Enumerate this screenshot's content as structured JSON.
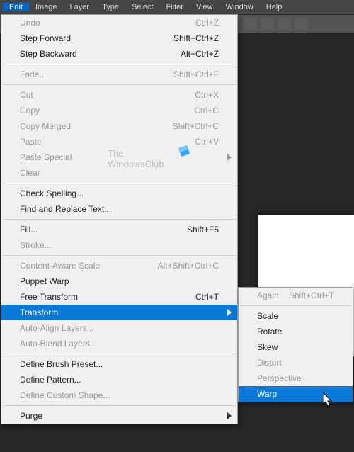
{
  "menubar": [
    "Edit",
    "Image",
    "Layer",
    "Type",
    "Select",
    "Filter",
    "View",
    "Window",
    "Help"
  ],
  "open_menu_index": 0,
  "watermark": {
    "line1": "The",
    "line2": "WindowsClub"
  },
  "menu": [
    {
      "t": "item",
      "label": "Undo",
      "shortcut": "Ctrl+Z",
      "disabled": true
    },
    {
      "t": "item",
      "label": "Step Forward",
      "shortcut": "Shift+Ctrl+Z"
    },
    {
      "t": "item",
      "label": "Step Backward",
      "shortcut": "Alt+Ctrl+Z"
    },
    {
      "t": "sep"
    },
    {
      "t": "item",
      "label": "Fade...",
      "shortcut": "Shift+Ctrl+F",
      "disabled": true
    },
    {
      "t": "sep"
    },
    {
      "t": "item",
      "label": "Cut",
      "shortcut": "Ctrl+X",
      "disabled": true
    },
    {
      "t": "item",
      "label": "Copy",
      "shortcut": "Ctrl+C",
      "disabled": true
    },
    {
      "t": "item",
      "label": "Copy Merged",
      "shortcut": "Shift+Ctrl+C",
      "disabled": true
    },
    {
      "t": "item",
      "label": "Paste",
      "shortcut": "Ctrl+V",
      "disabled": true
    },
    {
      "t": "item",
      "label": "Paste Special",
      "submenu": true,
      "disabled": true
    },
    {
      "t": "item",
      "label": "Clear",
      "disabled": true
    },
    {
      "t": "sep"
    },
    {
      "t": "item",
      "label": "Check Spelling..."
    },
    {
      "t": "item",
      "label": "Find and Replace Text..."
    },
    {
      "t": "sep"
    },
    {
      "t": "item",
      "label": "Fill...",
      "shortcut": "Shift+F5"
    },
    {
      "t": "item",
      "label": "Stroke...",
      "disabled": true
    },
    {
      "t": "sep"
    },
    {
      "t": "item",
      "label": "Content-Aware Scale",
      "shortcut": "Alt+Shift+Ctrl+C",
      "disabled": true
    },
    {
      "t": "item",
      "label": "Puppet Warp"
    },
    {
      "t": "item",
      "label": "Free Transform",
      "shortcut": "Ctrl+T"
    },
    {
      "t": "item",
      "label": "Transform",
      "submenu": true,
      "selected": true
    },
    {
      "t": "item",
      "label": "Auto-Align Layers...",
      "disabled": true
    },
    {
      "t": "item",
      "label": "Auto-Blend Layers...",
      "disabled": true
    },
    {
      "t": "sep"
    },
    {
      "t": "item",
      "label": "Define Brush Preset..."
    },
    {
      "t": "item",
      "label": "Define Pattern..."
    },
    {
      "t": "item",
      "label": "Define Custom Shape...",
      "disabled": true
    },
    {
      "t": "sep"
    },
    {
      "t": "item",
      "label": "Purge",
      "submenu": true
    }
  ],
  "submenu": [
    {
      "t": "item",
      "label": "Again",
      "shortcut": "Shift+Ctrl+T",
      "disabled": true
    },
    {
      "t": "sep"
    },
    {
      "t": "item",
      "label": "Scale"
    },
    {
      "t": "item",
      "label": "Rotate"
    },
    {
      "t": "item",
      "label": "Skew"
    },
    {
      "t": "item",
      "label": "Distort",
      "disabled": true
    },
    {
      "t": "item",
      "label": "Perspective",
      "disabled": true
    },
    {
      "t": "item",
      "label": "Warp",
      "selected": true
    }
  ]
}
